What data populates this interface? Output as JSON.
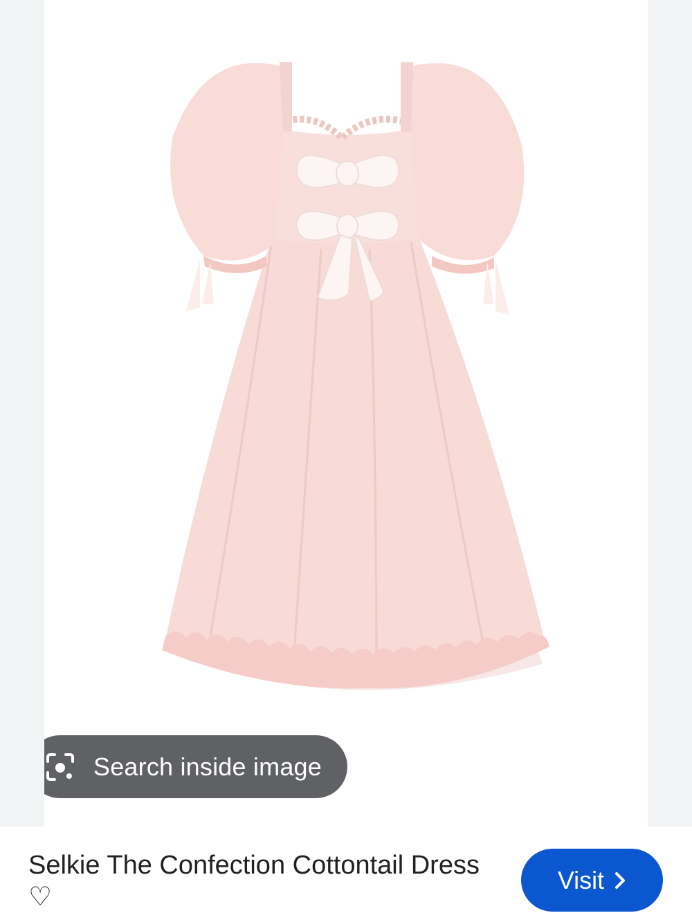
{
  "lens": {
    "label": "Search inside image",
    "icon": "lens-camera-icon"
  },
  "product": {
    "title": "Selkie The Confection Cottontail Dress ♡"
  },
  "visit": {
    "label": "Visit",
    "icon": "chevron-right-icon"
  },
  "colors": {
    "accent": "#0b57d0",
    "chip": "#5f6164",
    "dress": "#f7d9d5"
  }
}
